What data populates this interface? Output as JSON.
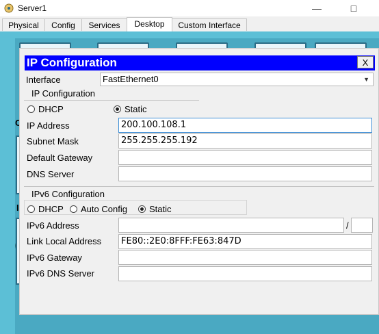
{
  "window": {
    "title": "Server1"
  },
  "tabs": [
    {
      "label": "Physical"
    },
    {
      "label": "Config"
    },
    {
      "label": "Services"
    },
    {
      "label": "Desktop"
    },
    {
      "label": "Custom Interface"
    }
  ],
  "dialog": {
    "title": "IP Configuration",
    "close_label": "X",
    "interface_label": "Interface",
    "interface_value": "FastEthernet0",
    "ipv4": {
      "group_title": "IP Configuration",
      "dhcp_label": "DHCP",
      "static_label": "Static",
      "mode": "Static",
      "ip_label": "IP Address",
      "ip_value": "200.100.108.1",
      "mask_label": "Subnet Mask",
      "mask_value": "255.255.255.192",
      "gateway_label": "Default Gateway",
      "gateway_value": "",
      "dns_label": "DNS Server",
      "dns_value": ""
    },
    "ipv6": {
      "group_title": "IPv6 Configuration",
      "dhcp_label": "DHCP",
      "auto_label": "Auto Config",
      "static_label": "Static",
      "mode": "Static",
      "address_label": "IPv6 Address",
      "address_value": "",
      "slash": "/",
      "prefix_value": "",
      "link_local_label": "Link Local Address",
      "link_local_value": "FE80::2E0:8FFF:FE63:847D",
      "gateway_label": "IPv6 Gateway",
      "gateway_value": "",
      "dns_label": "IPv6 DNS Server",
      "dns_value": ""
    }
  },
  "background_letters": {
    "a": "C",
    "b": "I",
    "c": "("
  },
  "colors": {
    "titlebar_blue": "#0000ff",
    "desktop": "#5cbfd6"
  }
}
